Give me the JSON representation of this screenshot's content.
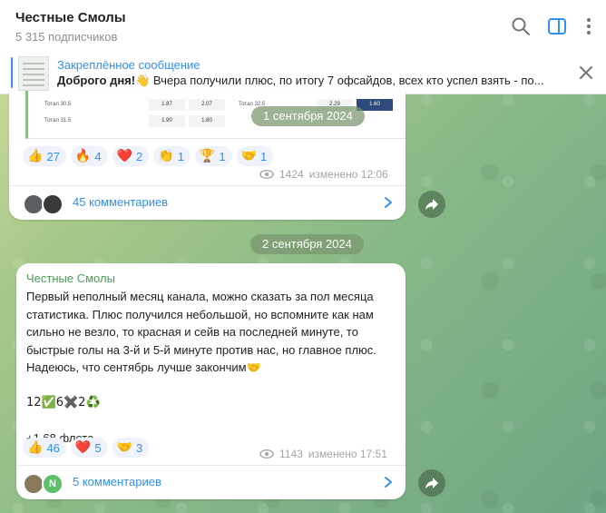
{
  "channel": {
    "name": "Честные Смолы",
    "subscribers": "5 315 подписчиков"
  },
  "pinned": {
    "title": "Закреплённое сообщение",
    "text_bold": "Доброго дня!👋",
    "text_rest": " Вчера получили плюс, по итогу 7 офсайдов, всех кто успел взять - по..."
  },
  "odds_snippet": {
    "row1": {
      "label": "Тотал 30.5",
      "a": "1.87",
      "b": "2.07",
      "label2": "Тотал 32.5",
      "c": "2.29",
      "d": "1.60"
    },
    "row2": {
      "label": "Тотал 31.5",
      "a": "1.90",
      "b": "1.80"
    }
  },
  "post1": {
    "date_chip": "1 сентября 2024",
    "reactions": [
      {
        "emoji": "👍",
        "count": "27"
      },
      {
        "emoji": "🔥",
        "count": "4"
      },
      {
        "emoji": "❤️",
        "count": "2"
      },
      {
        "emoji": "👏",
        "count": "1"
      },
      {
        "emoji": "🏆",
        "count": "1"
      },
      {
        "emoji": "🤝",
        "count": "1"
      }
    ],
    "views": "1424",
    "edited": "изменено 12:06",
    "comments": "45 комментариев"
  },
  "post2": {
    "date_chip": "2 сентября 2024",
    "author": "Честные Смолы",
    "text": "Первый неполный месяц канала, можно сказать за пол месяца статистика. Плюс получился небольшой, но вспомните как нам сильно не везло, то красная и сейв на последней минуте, то быстрые голы на 3-й и 5-й минуте против нас, но главное плюс. Надеюсь, что сентябрь лучше закончим🤝",
    "stats": "12✅6✖️2♻️",
    "result": "+1.68 флета",
    "reactions": [
      {
        "emoji": "👍",
        "count": "46"
      },
      {
        "emoji": "❤️",
        "count": "5"
      },
      {
        "emoji": "🤝",
        "count": "3"
      }
    ],
    "views": "1143",
    "edited": "изменено 17:51",
    "comments": "5 комментариев",
    "avatar_letter": "N"
  },
  "colors": {
    "accent": "#3390ec",
    "author": "#4a9b56",
    "reaction_bg": "#eef3fb"
  }
}
